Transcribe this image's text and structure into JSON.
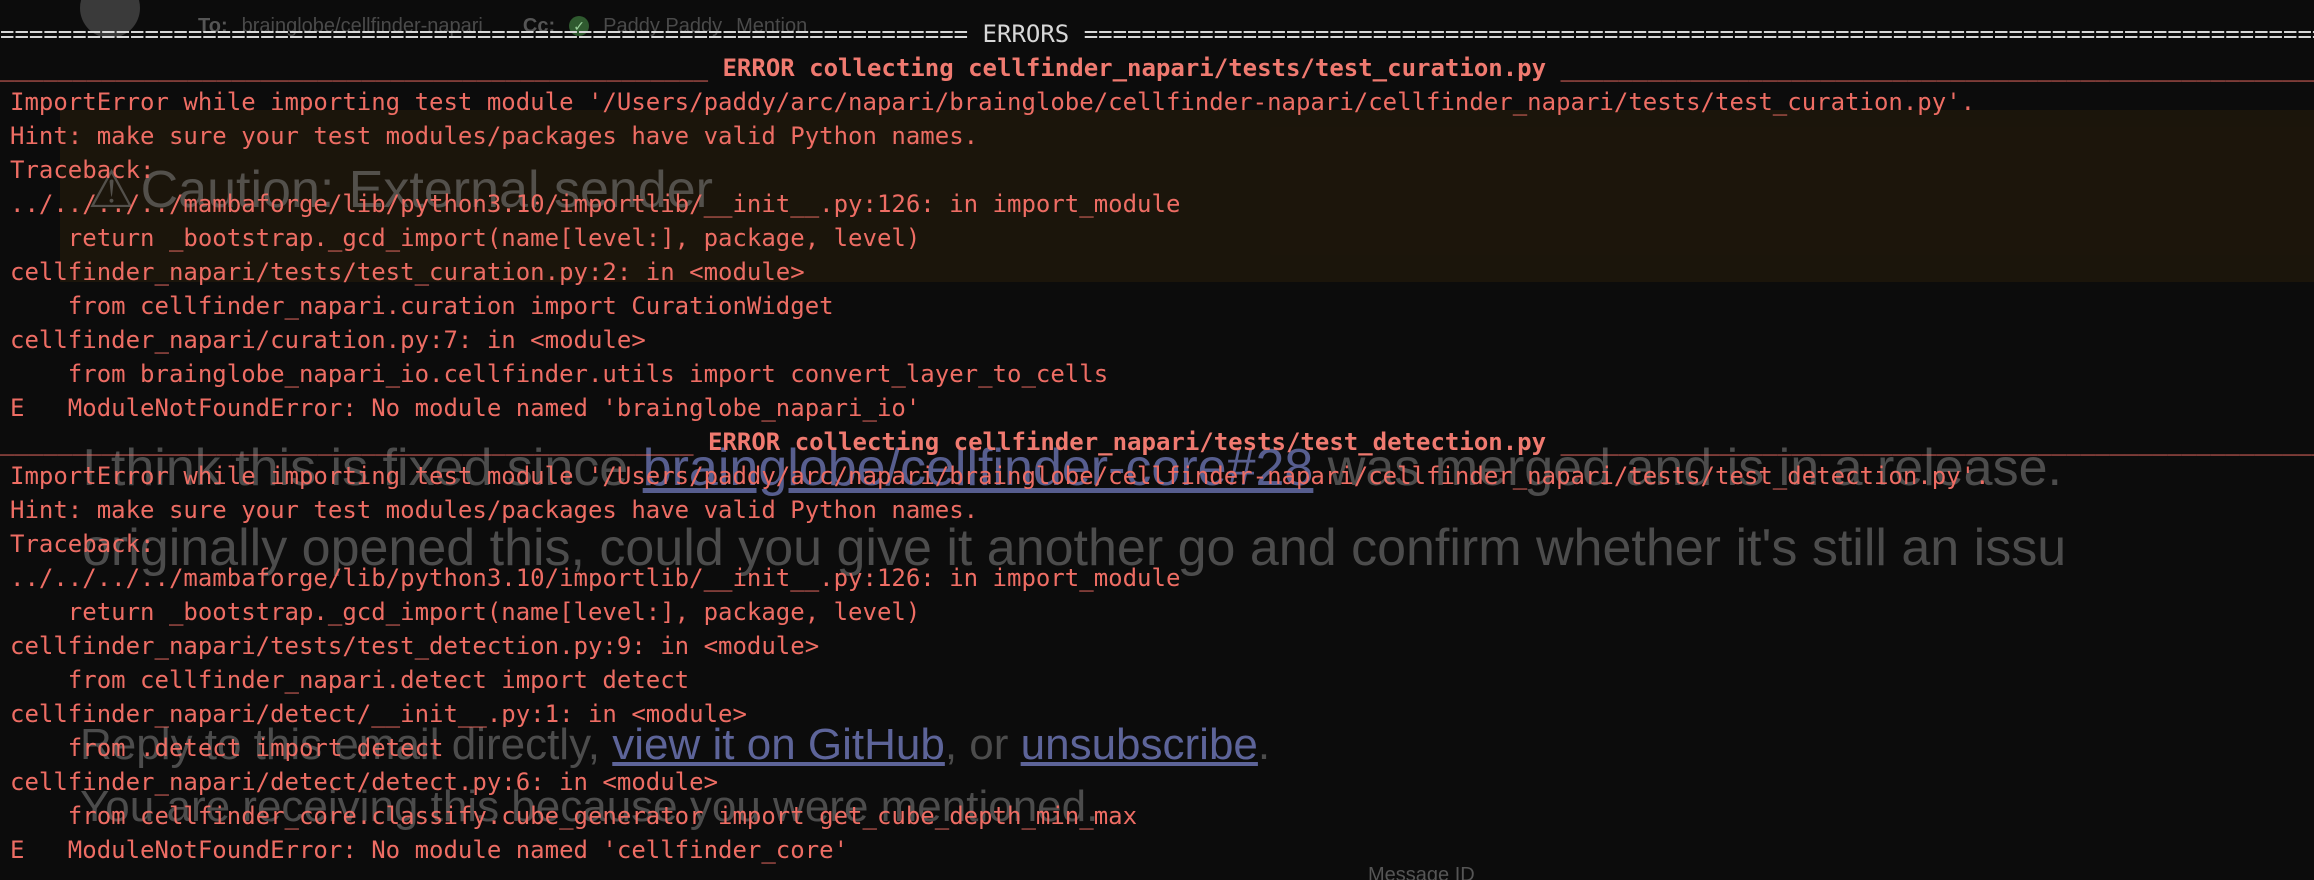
{
  "email": {
    "to_label": "To:",
    "to_value": "brainglobe/cellfinder-napari",
    "cc_label": "Cc:",
    "cc_name": "Paddy Paddy",
    "cc_mention": "Mention",
    "caution": "Caution: External sender",
    "comment": {
      "line1_before": "I think this is fixed since ",
      "line1_link": "brainglobe/cellfinder-core#28",
      "line1_after": " was merged and is in a release.",
      "line2": "originally opened this, could you give it another go and confirm whether it's still an issu"
    },
    "reply": {
      "before": "Reply to this email directly, ",
      "link1": "view it on GitHub",
      "middle": ", or ",
      "link2": "unsubscribe",
      "after": "."
    },
    "reason": "You are receiving this because you were mentioned.",
    "footer_fragment": "Message ID"
  },
  "terminal": {
    "errors_header": " ERRORS ",
    "sections": [
      {
        "header": " ERROR collecting cellfinder_napari/tests/test_curation.py ",
        "lines": [
          "ImportError while importing test module '/Users/paddy/arc/napari/brainglobe/cellfinder-napari/cellfinder_napari/tests/test_curation.py'.",
          "Hint: make sure your test modules/packages have valid Python names.",
          "Traceback:",
          "../../../../mambaforge/lib/python3.10/importlib/__init__.py:126: in import_module",
          "    return _bootstrap._gcd_import(name[level:], package, level)",
          "cellfinder_napari/tests/test_curation.py:2: in <module>",
          "    from cellfinder_napari.curation import CurationWidget",
          "cellfinder_napari/curation.py:7: in <module>",
          "    from brainglobe_napari_io.cellfinder.utils import convert_layer_to_cells",
          "E   ModuleNotFoundError: No module named 'brainglobe_napari_io'"
        ]
      },
      {
        "header": " ERROR collecting cellfinder_napari/tests/test_detection.py ",
        "lines": [
          "ImportError while importing test module '/Users/paddy/arc/napari/brainglobe/cellfinder-napari/cellfinder_napari/tests/test_detection.py'.",
          "Hint: make sure your test modules/packages have valid Python names.",
          "Traceback:",
          "../../../../mambaforge/lib/python3.10/importlib/__init__.py:126: in import_module",
          "    return _bootstrap._gcd_import(name[level:], package, level)",
          "cellfinder_napari/tests/test_detection.py:9: in <module>",
          "    from cellfinder_napari.detect import detect",
          "cellfinder_napari/detect/__init__.py:1: in <module>",
          "    from .detect import detect",
          "cellfinder_napari/detect/detect.py:6: in <module>",
          "    from cellfinder_core.classify.cube_generator import get_cube_depth_min_max",
          "E   ModuleNotFoundError: No module named 'cellfinder_core'"
        ]
      }
    ]
  }
}
